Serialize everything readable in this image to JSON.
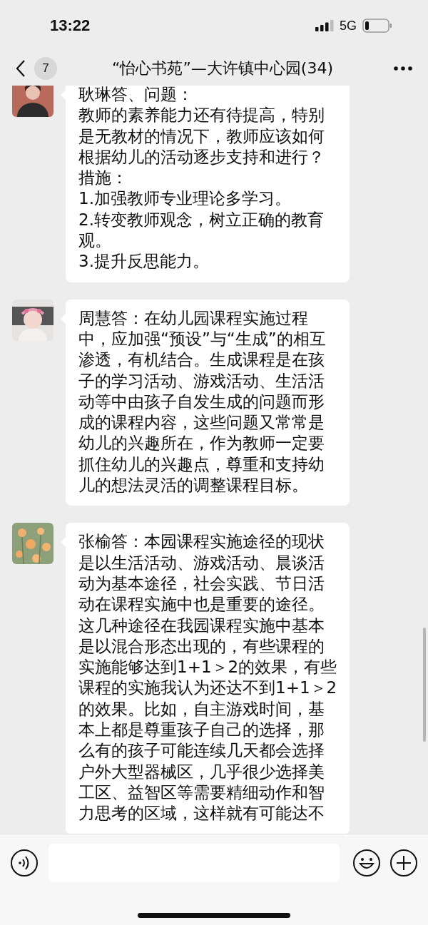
{
  "status_bar": {
    "time": "13:22",
    "network": "5G"
  },
  "nav": {
    "unread_count": "7",
    "title": "“怡心书苑”—大许镇中心园(34)"
  },
  "messages": [
    {
      "paragraphs": [
        "耿琳答、问题：",
        "教师的素养能力还有待提高，特别是无教材的情况下，教师应该如何根据幼儿的活动逐步支持和进行？",
        "措施：",
        "1.加强教师专业理论多学习。",
        "2.转变教师观念，树立正确的教育观。",
        "3.提升反思能力。"
      ]
    },
    {
      "paragraphs": [
        "周慧答：在幼儿园课程实施过程中，应加强“预设”与“生成”的相互渗透，有机结合。生成课程是在孩子的学习活动、游戏活动、生活活动等中由孩子自发生成的问题而形成的课程内容，这些问题又常常是幼儿的兴趣所在，作为教师一定要抓住幼儿的兴趣点，尊重和支持幼儿的想法灵活的调整课程目标。"
      ]
    },
    {
      "paragraphs": [
        "张榆答：本园课程实施途径的现状是以生活活动、游戏活动、晨谈活动为基本途径，社会实践、节日活动在课程实施中也是重要的途径。这几种途径在我园课程实施中基本是以混合形态出现的，有些课程的实施能够达到1+1＞2的效果，有些课程的实施我认为还达不到1+1＞2的效果。比如，自主游戏时间，基本上都是尊重孩子自己的选择，那么有的孩子可能连续几天都会选择户外大型器械区，几乎很少选择美工区、益智区等需要精细动作和智力思考的区域，这样就有可能达不"
      ]
    }
  ]
}
